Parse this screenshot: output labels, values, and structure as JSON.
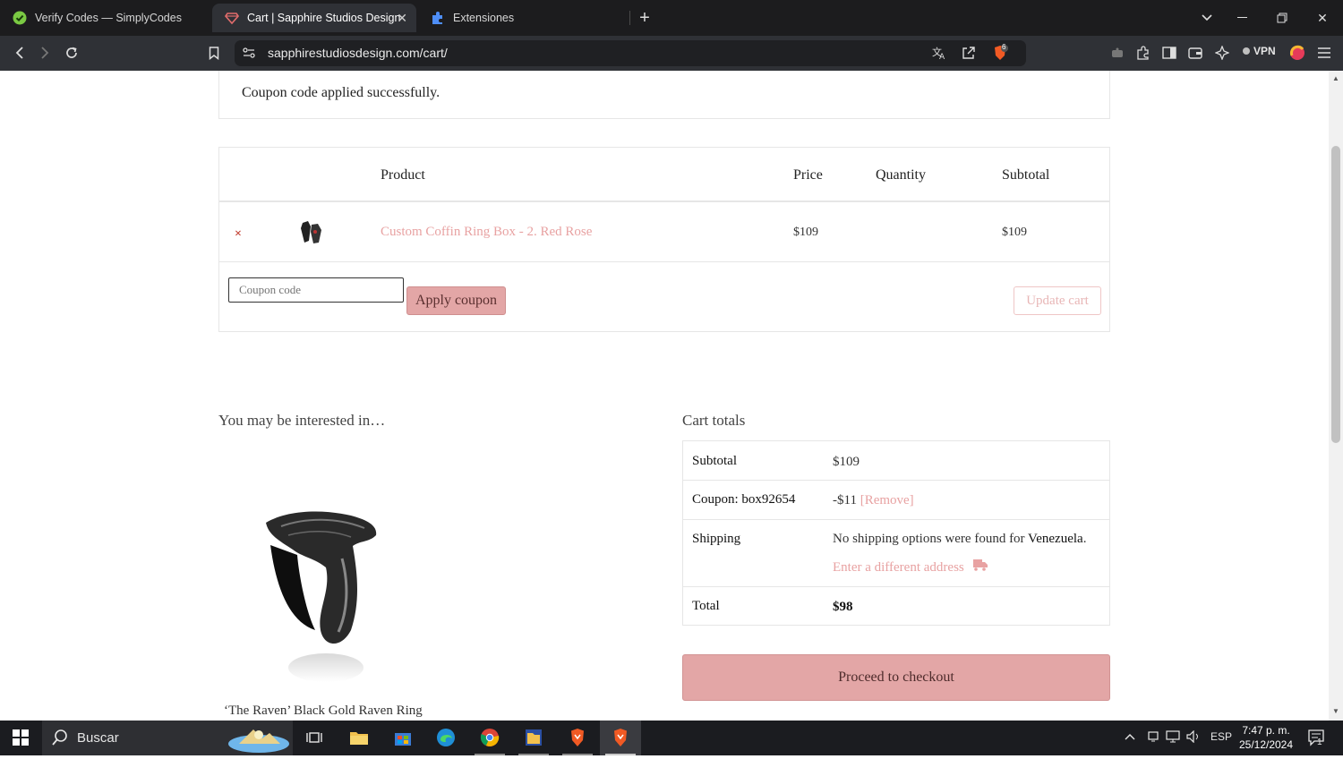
{
  "browser": {
    "tabs": [
      {
        "title": "Verify Codes — SimplyCodes",
        "icon": "simplycodes-check-icon"
      },
      {
        "title": "Cart | Sapphire Studios Design",
        "icon": "sapphire-gem-icon",
        "active": true
      },
      {
        "title": "Extensiones",
        "icon": "puzzle-icon"
      }
    ],
    "url": "sapphirestudiosdesign.com/cart/",
    "brave_badge": "6",
    "vpn_label": "VPN"
  },
  "notice": {
    "message": "Coupon code applied successfully."
  },
  "cart": {
    "headers": {
      "product": "Product",
      "price": "Price",
      "quantity": "Quantity",
      "subtotal": "Subtotal"
    },
    "items": [
      {
        "name": "Custom Coffin Ring Box - 2. Red Rose",
        "price": "$109",
        "quantity": "",
        "subtotal": "$109",
        "remove": "×"
      }
    ],
    "coupon_placeholder": "Coupon code",
    "apply_label": "Apply coupon",
    "update_label": "Update cart"
  },
  "cross_sells": {
    "title": "You may be interested in…",
    "products": [
      {
        "name": "‘The Raven’ Black Gold Raven Ring"
      }
    ]
  },
  "totals": {
    "title": "Cart totals",
    "subtotal_label": "Subtotal",
    "subtotal_value": "$109",
    "coupon_label": "Coupon: box92654",
    "coupon_value": "-$11",
    "coupon_remove": "[Remove]",
    "shipping_label": "Shipping",
    "shipping_message_prefix": "No shipping options were found for",
    "shipping_country": "Venezuela",
    "shipping_message_suffix": ".",
    "shipping_change": "Enter a different address",
    "total_label": "Total",
    "total_value": "$98",
    "checkout_label": "Proceed to checkout"
  },
  "taskbar": {
    "search_label": "Buscar",
    "language": "ESP",
    "time": "7:47 p. m.",
    "date": "25/12/2024",
    "notification_count": "1"
  },
  "colors": {
    "accent": "#e3a6a6",
    "link": "#e8a2a2",
    "remove": "#c0392b"
  }
}
